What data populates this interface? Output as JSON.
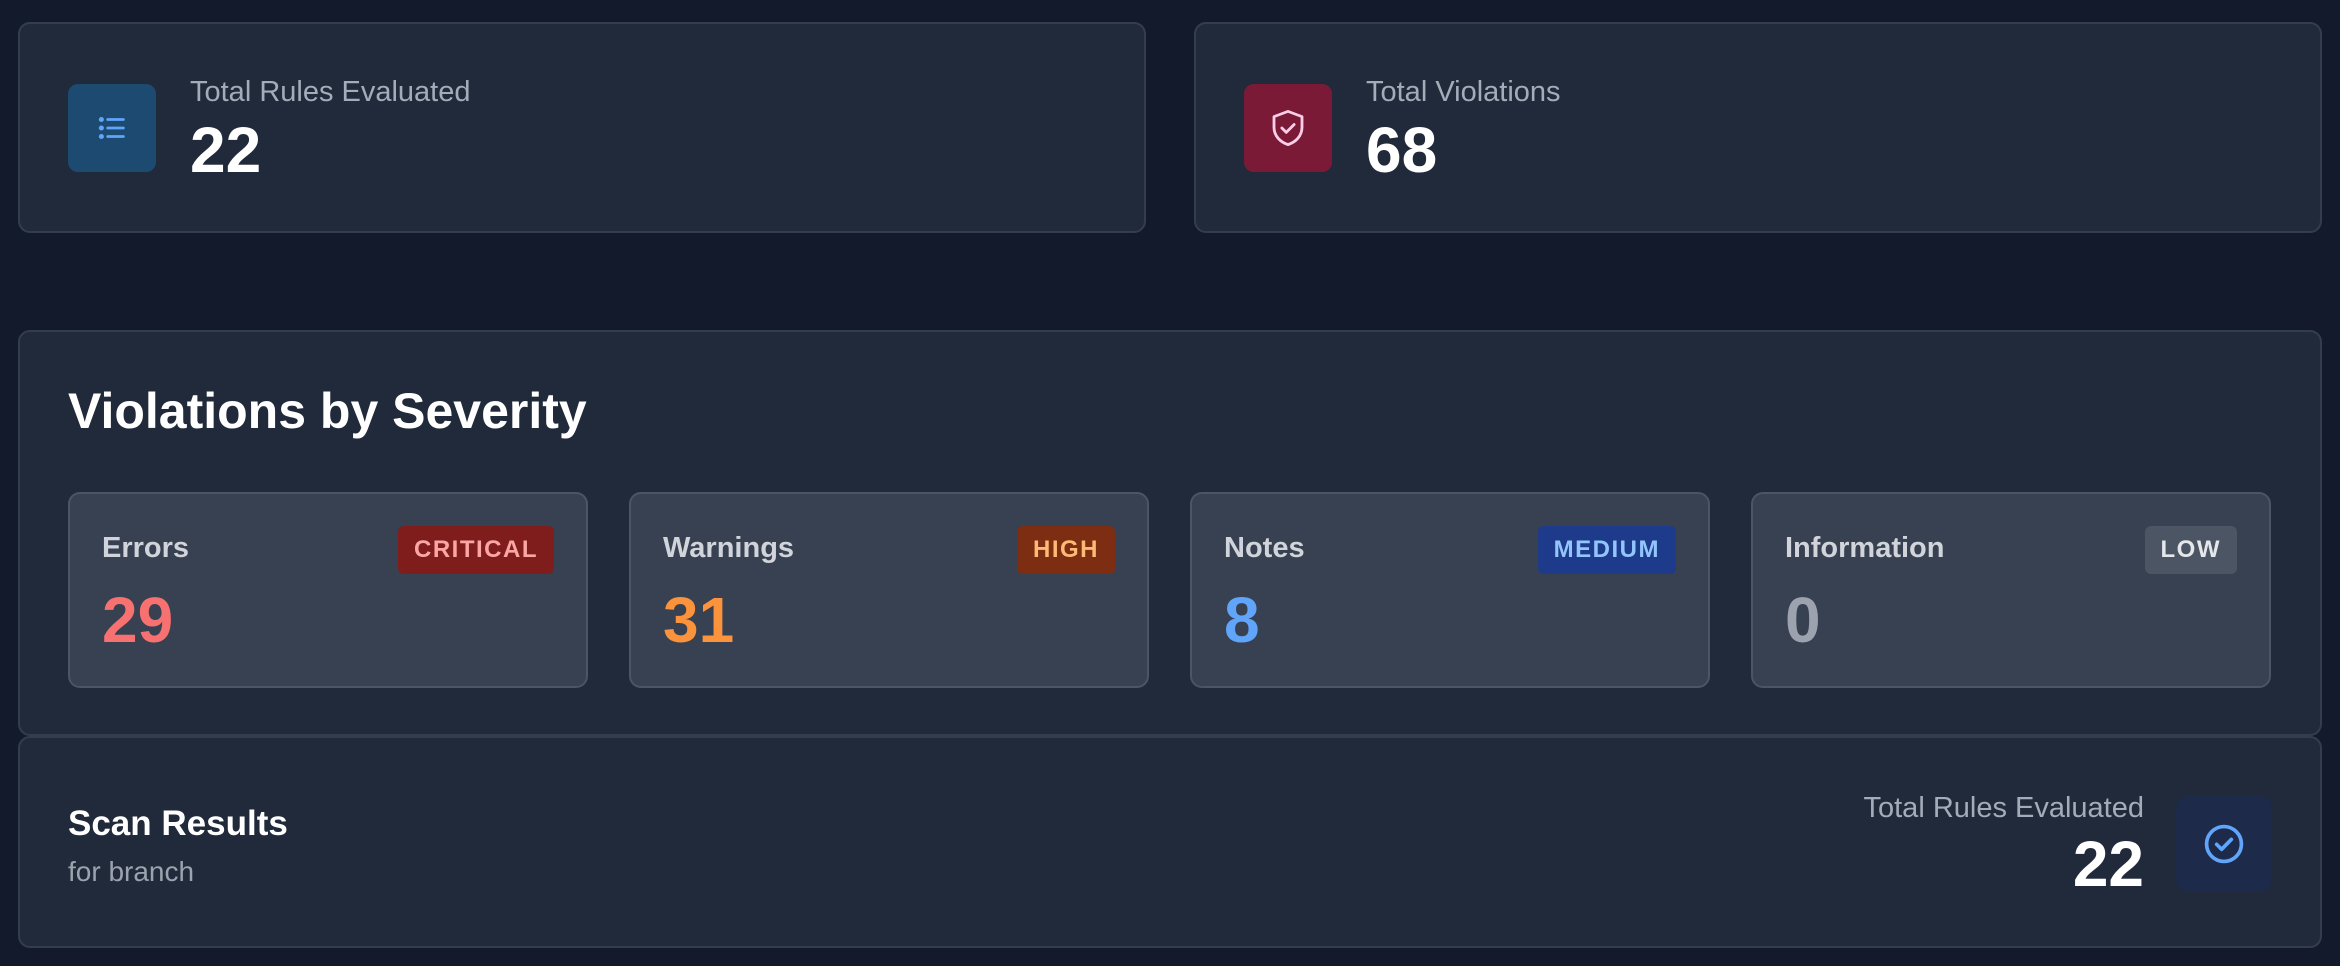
{
  "stats": [
    {
      "label": "Total Rules Evaluated",
      "value": "22",
      "icon": "list-icon",
      "color": "#1d4a70"
    },
    {
      "label": "Total Violations",
      "value": "68",
      "icon": "shield-check-icon",
      "color": "#7b1a36"
    }
  ],
  "severity": {
    "title": "Violations by Severity",
    "cards": [
      {
        "label": "Errors",
        "badge": "CRITICAL",
        "value": "29",
        "value_color": "#f87171",
        "badge_bg": "#7f1d1d",
        "badge_fg": "#fca5a5"
      },
      {
        "label": "Warnings",
        "badge": "HIGH",
        "value": "31",
        "value_color": "#fb923c",
        "badge_bg": "#7c2d12",
        "badge_fg": "#fdba74"
      },
      {
        "label": "Notes",
        "badge": "MEDIUM",
        "value": "8",
        "value_color": "#60a5fa",
        "badge_bg": "#1e3a8a",
        "badge_fg": "#93c5fd"
      },
      {
        "label": "Information",
        "badge": "LOW",
        "value": "0",
        "value_color": "#9ca3af",
        "badge_bg": "#4b5563",
        "badge_fg": "#e5e7eb"
      }
    ]
  },
  "scan": {
    "title": "Scan Results",
    "subtitle": "for branch",
    "right_label": "Total Rules Evaluated",
    "right_value": "22",
    "icon": "check-circle-icon"
  }
}
